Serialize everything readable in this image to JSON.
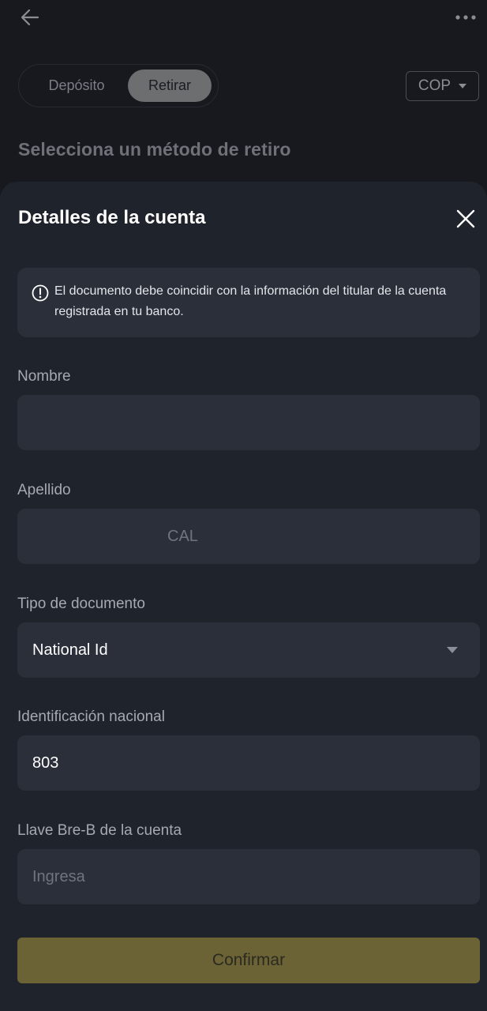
{
  "topbar": {
    "back_icon": "arrow-left-icon",
    "more_icon": "more-horizontal-icon"
  },
  "mode_toggle": {
    "deposit_label": "Depósito",
    "withdraw_label": "Retirar",
    "selected": "Retirar"
  },
  "currency": {
    "value": "COP",
    "icon": "caret-down-icon"
  },
  "background_heading": "Selecciona un método de retiro",
  "sheet": {
    "title": "Detalles de la cuenta",
    "close_icon": "close-icon",
    "notice": {
      "icon": "info-circle-icon",
      "text": "El documento debe coincidir con la información del titular de la cuenta registrada en tu banco."
    },
    "fields": {
      "first_name": {
        "label": "Nombre",
        "value": ""
      },
      "last_name": {
        "label": "Apellido",
        "value": "CAL"
      },
      "document_type": {
        "label": "Tipo de documento",
        "value": "National Id"
      },
      "national_id": {
        "label": "Identificación nacional",
        "value": "803"
      },
      "breb_key": {
        "label": "Llave Bre-B de la cuenta",
        "placeholder": "Ingresa"
      }
    },
    "confirm_label": "Confirmar"
  },
  "colors": {
    "page_bg": "#17191e",
    "sheet_bg": "#1f232c",
    "field_bg": "#2a2f3a",
    "confirm_bg": "#6b6235",
    "segment_selected_bg": "#6d6e70"
  }
}
